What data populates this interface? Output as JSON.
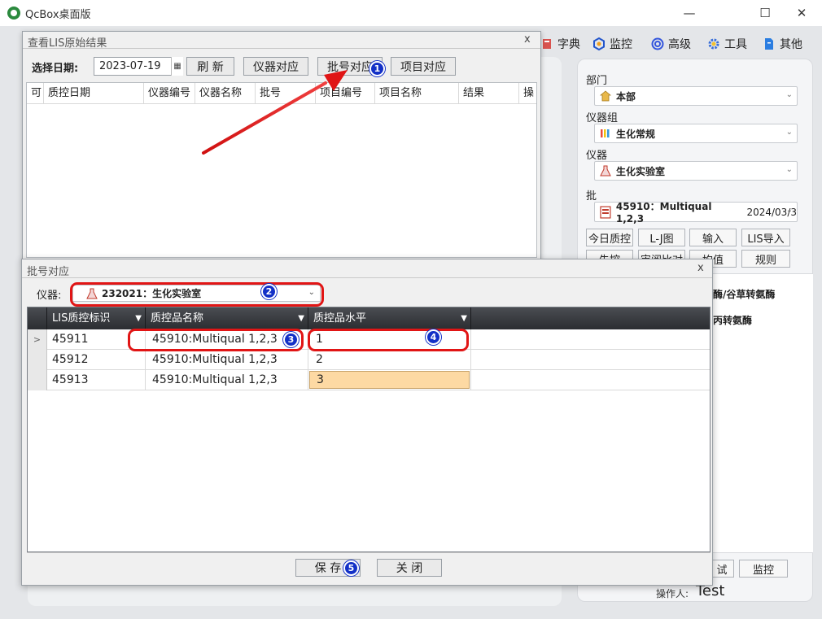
{
  "app": {
    "title": "QcBox桌面版",
    "toolbar": [
      {
        "label": "字典",
        "icon": "dictionary-icon"
      },
      {
        "label": "监控",
        "icon": "monitor-icon"
      },
      {
        "label": "高级",
        "icon": "advanced-icon"
      },
      {
        "label": "工具",
        "icon": "tools-gear-icon"
      },
      {
        "label": "其他",
        "icon": "other-icon"
      }
    ],
    "window_controls": {
      "minimize": "—",
      "maximize": "☐",
      "close": "✕"
    }
  },
  "right_panel": {
    "dept_label": "部门",
    "dept_value": "本部",
    "group_label": "仪器组",
    "group_value": "生化常规",
    "instrument_label": "仪器",
    "instrument_value": "生化实验室",
    "batch_label": "批",
    "batch_value": "45910：Multiqual 1,2,3",
    "batch_date": "2024/03/3",
    "buttons_row1": [
      "今日质控",
      "L-J图",
      "输入",
      "LIS导入"
    ],
    "buttons_row2": [
      "失控",
      "审阅比对",
      "均值",
      "规则"
    ],
    "partial_texts": [
      "酶/谷草转氨酶",
      "丙转氨酶"
    ],
    "bottom_buttons": [
      "试",
      "监控"
    ],
    "operator_label": "操作人:",
    "operator_value": "Test"
  },
  "lis_window": {
    "title": "查看LIS原始结果",
    "close": "x",
    "date_label": "选择日期:",
    "date_value": "2023-07-19",
    "buttons": [
      "刷 新",
      "仪器对应",
      "批号对应",
      "项目对应"
    ],
    "columns": [
      "可",
      "质控日期",
      "仪器编号",
      "仪器名称",
      "批号",
      "项目编号",
      "项目名称",
      "结果",
      "操"
    ]
  },
  "batch_dialog": {
    "title": "批号对应",
    "close": "x",
    "instrument_label": "仪器:",
    "instrument_value": "232021：生化实验室",
    "columns": [
      "LIS质控标识",
      "质控品名称",
      "质控品水平"
    ],
    "rows": [
      {
        "marker": ">",
        "lis_id": "45911",
        "name": "45910:Multiqual 1,2,3",
        "level": "1"
      },
      {
        "marker": "",
        "lis_id": "45912",
        "name": "45910:Multiqual 1,2,3",
        "level": "2"
      },
      {
        "marker": "",
        "lis_id": "45913",
        "name": "45910:Multiqual 1,2,3",
        "level": "3"
      }
    ],
    "save_label": "保 存",
    "close_label": "关 闭"
  },
  "annotations": {
    "badges": [
      "1",
      "2",
      "3",
      "4",
      "5"
    ]
  },
  "colors": {
    "annotation_red": "#e11515",
    "badge_blue": "#1330c7",
    "grid_header_dark": "#2b2d31",
    "edit_cell": "#fdd9a3"
  }
}
